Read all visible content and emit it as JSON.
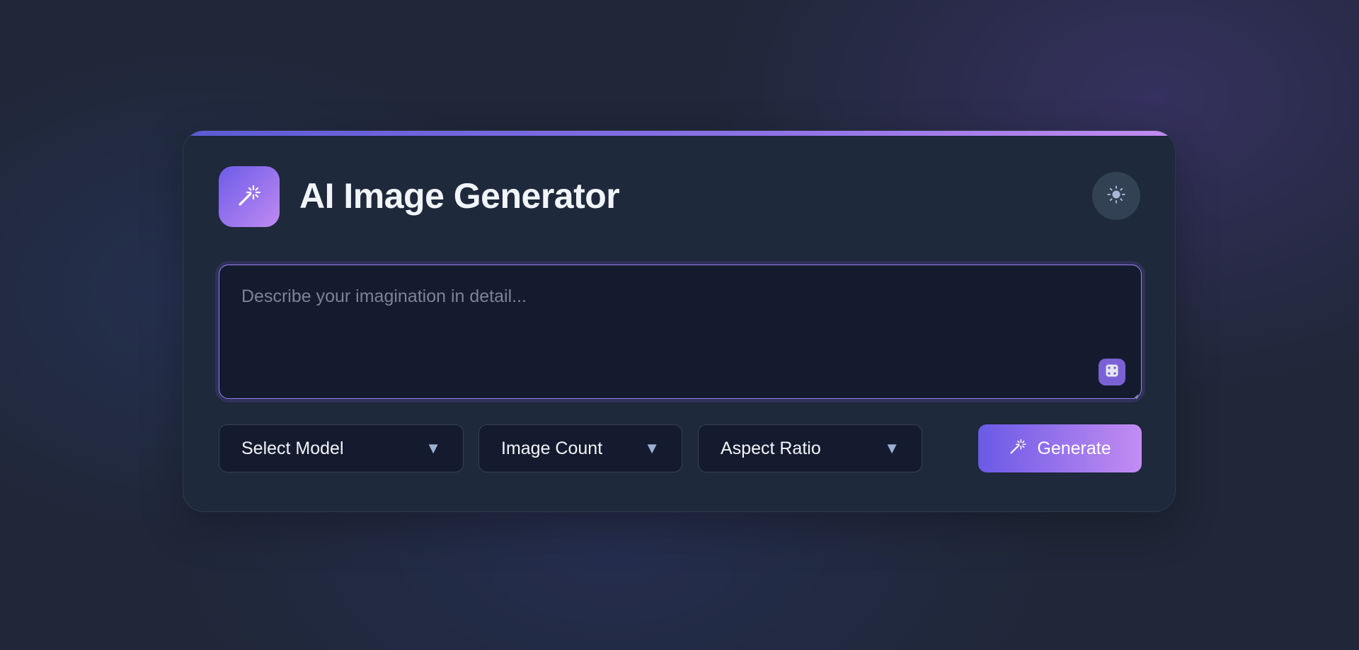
{
  "header": {
    "title": "AI Image Generator",
    "logo_icon": "magic-wand-icon",
    "theme_toggle_icon": "sun-icon"
  },
  "prompt": {
    "value": "",
    "placeholder": "Describe your imagination in detail...",
    "random_button_icon": "dice-icon"
  },
  "controls": {
    "model": {
      "label": "Select Model",
      "icon": "chevron-down-icon"
    },
    "count": {
      "label": "Image Count",
      "icon": "chevron-down-icon"
    },
    "ratio": {
      "label": "Aspect Ratio",
      "icon": "chevron-down-icon"
    },
    "chevron_glyph": "▼",
    "generate": {
      "label": "Generate",
      "icon": "magic-wand-icon"
    }
  },
  "colors": {
    "accent_start": "#6a5ae6",
    "accent_end": "#c38cf2",
    "card_bg": "#1e293b",
    "input_bg": "#151b2e"
  }
}
